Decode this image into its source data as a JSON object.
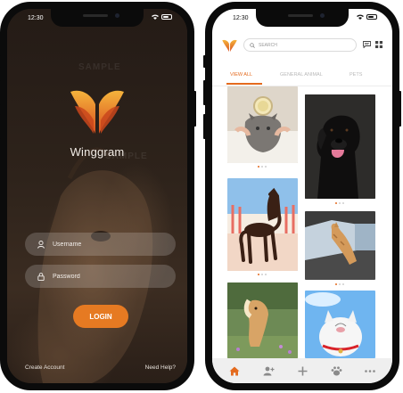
{
  "login_screen": {
    "status_time": "12:30",
    "brand_name": "Winggram",
    "watermark": "SAMPLE",
    "username_placeholder": "Username",
    "password_placeholder": "Password",
    "login_label": "LOGIN",
    "create_account_label": "Create Account",
    "help_label": "Need Help?",
    "accent_color": "#e67a22",
    "icons": {
      "username": "user-icon",
      "password": "lock-icon",
      "logo": "wing-logo-icon"
    }
  },
  "feed_screen": {
    "status_time": "12:30",
    "search_placeholder": "SEARCH",
    "tabs": [
      {
        "label": "VIEW ALL",
        "active": true
      },
      {
        "label": "GENERAL ANIMAL",
        "active": false
      },
      {
        "label": "PETS",
        "active": false
      }
    ],
    "accent_color": "#e46a1e",
    "header_icons": [
      "chat-icon",
      "grid-icon"
    ],
    "posts": [
      {
        "subject": "cat with cup photo",
        "column": "left"
      },
      {
        "subject": "black labrador dog photo",
        "column": "right"
      },
      {
        "subject": "brown horse photo",
        "column": "left"
      },
      {
        "subject": "cat in car window photo",
        "column": "right"
      },
      {
        "subject": "pony in field photo",
        "column": "left"
      },
      {
        "subject": "white cat photo",
        "column": "right"
      }
    ],
    "bottom_nav": [
      "home-icon",
      "add-user-icon",
      "plus-icon",
      "paw-icon",
      "more-icon"
    ]
  }
}
